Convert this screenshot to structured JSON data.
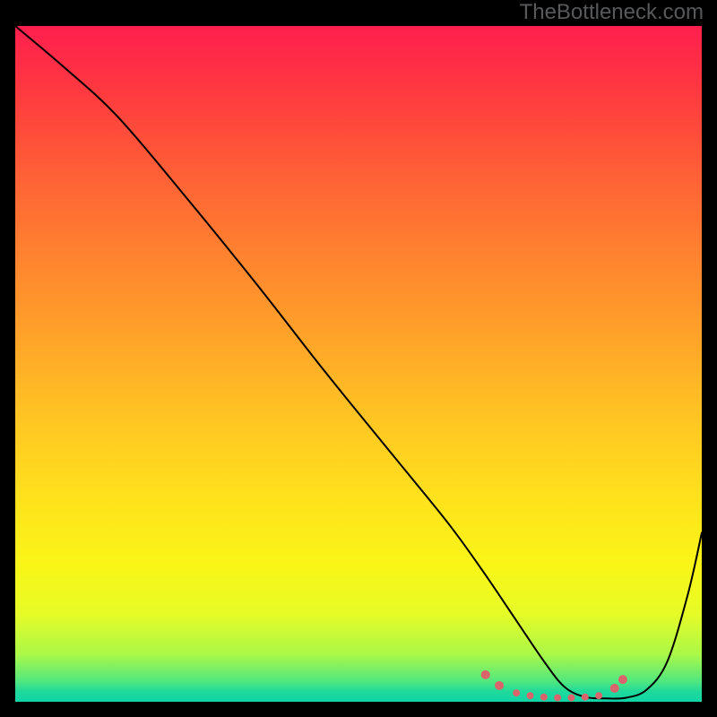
{
  "watermark": "TheBottleneck.com",
  "chart_data": {
    "type": "line",
    "title": "",
    "xlabel": "",
    "ylabel": "",
    "xlim": [
      0,
      100
    ],
    "ylim": [
      0,
      100
    ],
    "grid": false,
    "legend": false,
    "series": [
      {
        "name": "curve",
        "x": [
          0,
          7,
          15,
          25,
          35,
          45,
          55,
          63,
          68,
          73,
          77,
          80,
          83,
          86,
          89,
          92,
          95,
          98,
          100
        ],
        "y": [
          100,
          94,
          86.5,
          74.5,
          62,
          49,
          36.5,
          26.5,
          19.5,
          12,
          6,
          2.2,
          0.7,
          0.5,
          0.6,
          1.8,
          6,
          16,
          25
        ],
        "color": "#000000"
      }
    ],
    "markers": {
      "color": "#d9646c",
      "points": [
        {
          "x": 68.5,
          "y": 4.0,
          "r": 5
        },
        {
          "x": 70.5,
          "y": 2.4,
          "r": 5
        },
        {
          "x": 73.0,
          "y": 1.3,
          "r": 4
        },
        {
          "x": 75.0,
          "y": 0.9,
          "r": 4
        },
        {
          "x": 77.0,
          "y": 0.7,
          "r": 4
        },
        {
          "x": 79.0,
          "y": 0.6,
          "r": 4
        },
        {
          "x": 81.0,
          "y": 0.6,
          "r": 4
        },
        {
          "x": 83.0,
          "y": 0.7,
          "r": 4
        },
        {
          "x": 85.0,
          "y": 0.9,
          "r": 4
        },
        {
          "x": 87.3,
          "y": 2.0,
          "r": 5
        },
        {
          "x": 88.5,
          "y": 3.3,
          "r": 5
        }
      ]
    },
    "gradient_stops": [
      {
        "pos": 0,
        "color": "#ff1f4e"
      },
      {
        "pos": 10,
        "color": "#ff3a3f"
      },
      {
        "pos": 22,
        "color": "#ff6036"
      },
      {
        "pos": 33,
        "color": "#ff8030"
      },
      {
        "pos": 46,
        "color": "#ffa329"
      },
      {
        "pos": 58,
        "color": "#ffc523"
      },
      {
        "pos": 71,
        "color": "#ffe41c"
      },
      {
        "pos": 80,
        "color": "#f9f617"
      },
      {
        "pos": 87,
        "color": "#e6fb27"
      },
      {
        "pos": 93,
        "color": "#aaf848"
      },
      {
        "pos": 97,
        "color": "#50e77f"
      },
      {
        "pos": 98.5,
        "color": "#1fd99b"
      },
      {
        "pos": 100,
        "color": "#0fd4a7"
      }
    ]
  }
}
